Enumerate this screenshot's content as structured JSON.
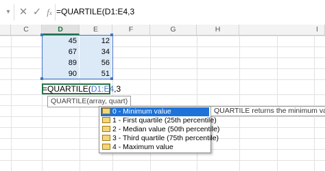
{
  "formula_bar": {
    "dropdown_icon": "chevron-down-icon",
    "cancel_icon": "x-icon",
    "enter_icon": "check-icon",
    "function_icon": "fx-icon",
    "content": "=QUARTILE(D1:E4,3"
  },
  "columns": [
    {
      "label": "C",
      "selected": false
    },
    {
      "label": "D",
      "selected": true
    },
    {
      "label": "E",
      "selected": false
    },
    {
      "label": "F",
      "selected": false
    },
    {
      "label": "G",
      "selected": false
    },
    {
      "label": "H",
      "selected": false
    },
    {
      "label": "I",
      "selected": false
    }
  ],
  "cells": {
    "D": [
      "45",
      "67",
      "89",
      "90"
    ],
    "E": [
      "12",
      "34",
      "56",
      "51"
    ]
  },
  "edit_cell": {
    "prefix": "=QUARTILE(",
    "ref": "D1:E4",
    "suffix": ",3"
  },
  "function_tooltip": "QUARTILE(array, quart)",
  "dropdown": {
    "items": [
      {
        "label": "0 - Minimum value",
        "selected": true
      },
      {
        "label": "1 - First quartile (25th percentile)",
        "selected": false
      },
      {
        "label": "2 - Median value (50th percentile)",
        "selected": false
      },
      {
        "label": "3 - Third quartile (75th percentile)",
        "selected": false
      },
      {
        "label": "4 - Maximum value",
        "selected": false
      }
    ],
    "description": "QUARTILE returns the minimum value"
  },
  "colors": {
    "accent": "#217346",
    "range": "#4472c4",
    "selection": "#1e73d8"
  }
}
